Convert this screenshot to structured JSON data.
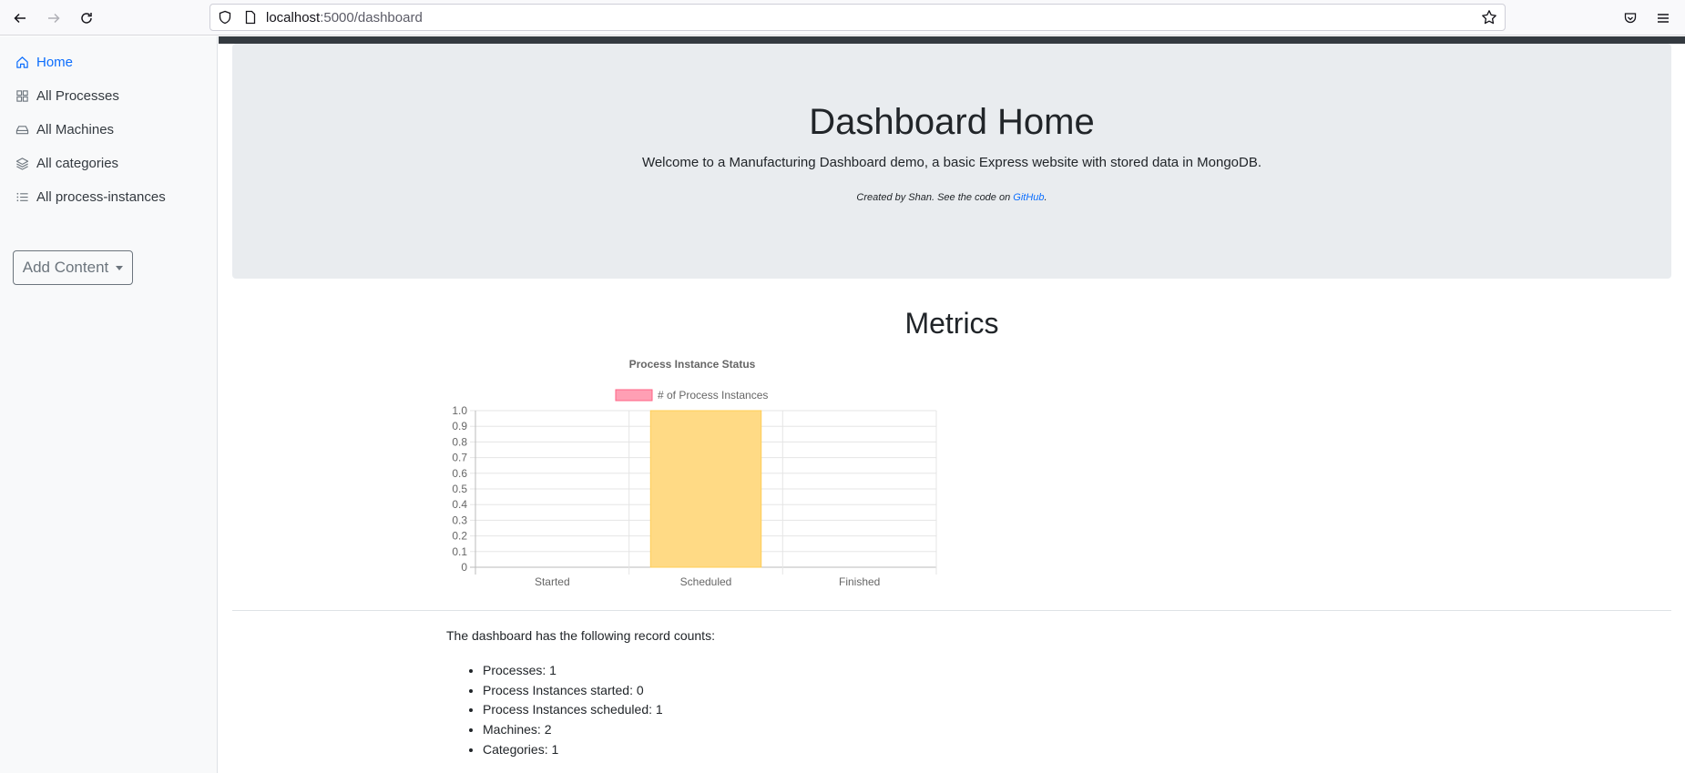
{
  "browser": {
    "url_host": "localhost",
    "url_path": ":5000/dashboard"
  },
  "sidebar": {
    "items": [
      {
        "label": "Home",
        "icon": "home-icon"
      },
      {
        "label": "All Processes",
        "icon": "grid-icon"
      },
      {
        "label": "All Machines",
        "icon": "hdd-icon"
      },
      {
        "label": "All categories",
        "icon": "layers-icon"
      },
      {
        "label": "All process-instances",
        "icon": "list-icon"
      }
    ],
    "add_content_label": "Add Content"
  },
  "hero": {
    "title": "Dashboard Home",
    "lead": "Welcome to a Manufacturing Dashboard demo, a basic Express website with stored data in MongoDB.",
    "credit_prefix": "Created by Shan. See the code on ",
    "credit_link": "GitHub",
    "credit_suffix": "."
  },
  "metrics": {
    "title": "Metrics",
    "counts_intro": "The dashboard has the following record counts:",
    "counts": [
      "Processes: 1",
      "Process Instances started: 0",
      "Process Instances scheduled: 1",
      "Machines: 2",
      "Categories: 1"
    ]
  },
  "chart_data": {
    "type": "bar",
    "title": "Process Instance Status",
    "categories": [
      "Started",
      "Scheduled",
      "Finished"
    ],
    "series": [
      {
        "name": "# of Process Instances",
        "values": [
          0,
          1,
          0
        ]
      }
    ],
    "ylim": [
      0,
      1
    ],
    "yticks": [
      "1.0",
      "0.9",
      "0.8",
      "0.7",
      "0.6",
      "0.5",
      "0.4",
      "0.3",
      "0.2",
      "0.1",
      "0"
    ],
    "grid": true,
    "legend": "top",
    "colors": {
      "legend_swatch": "#ff9fb4",
      "bar_fill": "#ffda85",
      "bar_border": "#ffcd56"
    }
  }
}
